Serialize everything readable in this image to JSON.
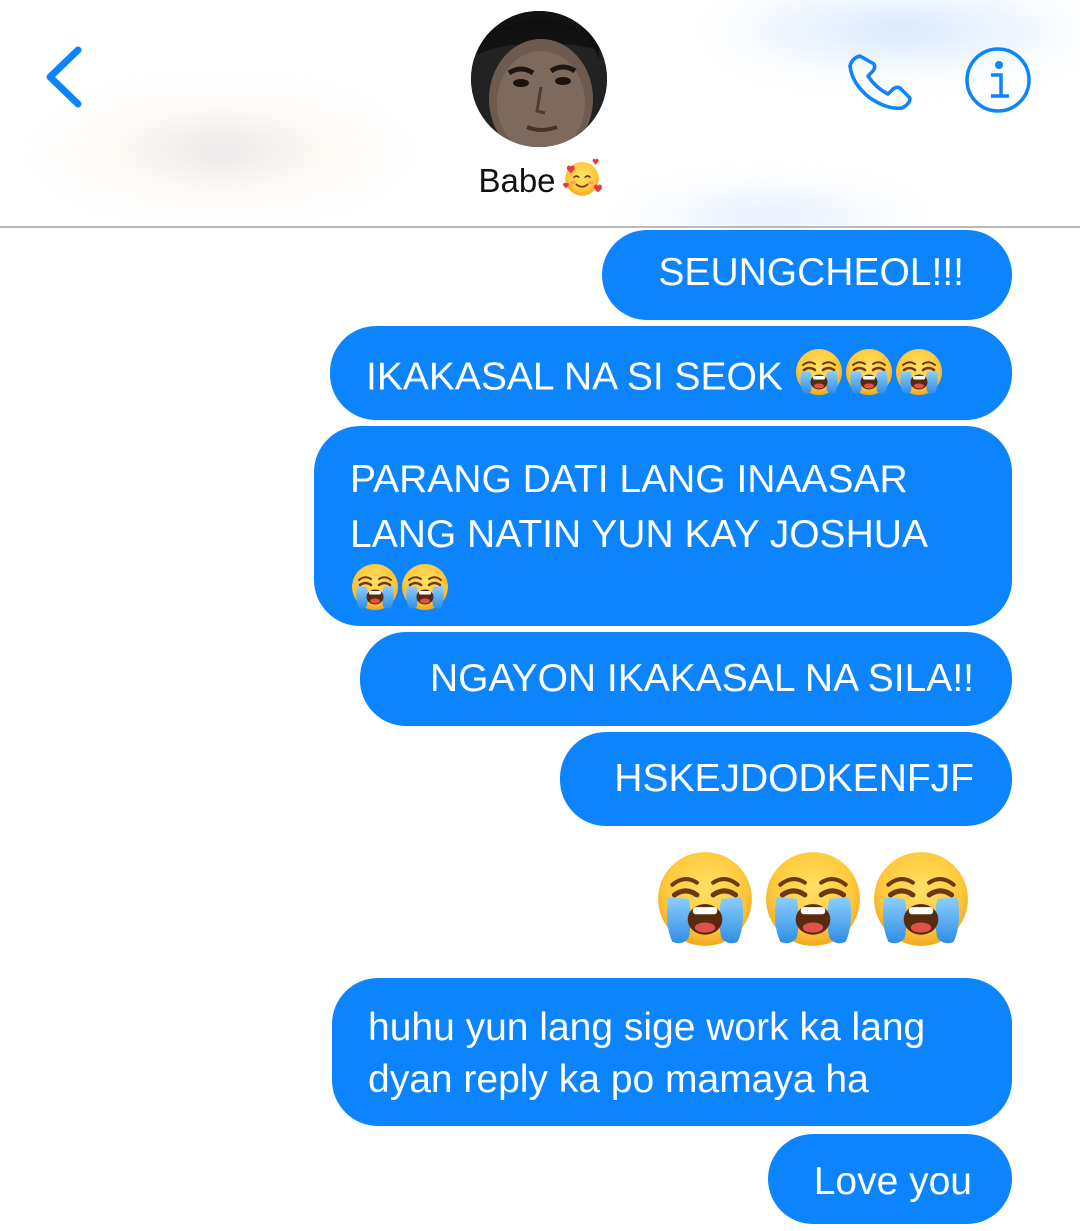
{
  "header": {
    "back_icon": "chevron-left-icon",
    "contact_name": "Babe",
    "contact_emoji": "smiling-face-with-hearts",
    "phone_icon": "phone-icon",
    "info_icon": "info-icon",
    "accent_color": "#0b84fe"
  },
  "messages": [
    {
      "id": "m1",
      "text": "SEUNGCHEOL!!!",
      "emoji_count": 0
    },
    {
      "id": "m2",
      "text": "IKAKASAL NA SI SEOK ",
      "emoji_count": 3,
      "emoji": "loudly-crying-face"
    },
    {
      "id": "m3",
      "lines": [
        "PARANG DATI LANG INAASAR",
        "LANG NATIN YUN KAY JOSHUA"
      ],
      "emoji_count": 2,
      "emoji": "loudly-crying-face"
    },
    {
      "id": "m4",
      "text": "NGAYON IKAKASAL NA SILA!!",
      "emoji_count": 0
    },
    {
      "id": "m5",
      "text": "HSKEJDODKENFJF",
      "emoji_count": 0
    },
    {
      "id": "m6",
      "big_emoji": "loudly-crying-face",
      "emoji_count": 3
    },
    {
      "id": "m7",
      "lines": [
        "huhu yun lang sige work ka lang",
        "dyan reply ka po mamaya ha"
      ],
      "emoji_count": 0
    },
    {
      "id": "m8",
      "text": "Love you",
      "emoji_count": 0
    }
  ],
  "bubble_color": "#0b84fe",
  "bubble_text_color": "#ffffff"
}
